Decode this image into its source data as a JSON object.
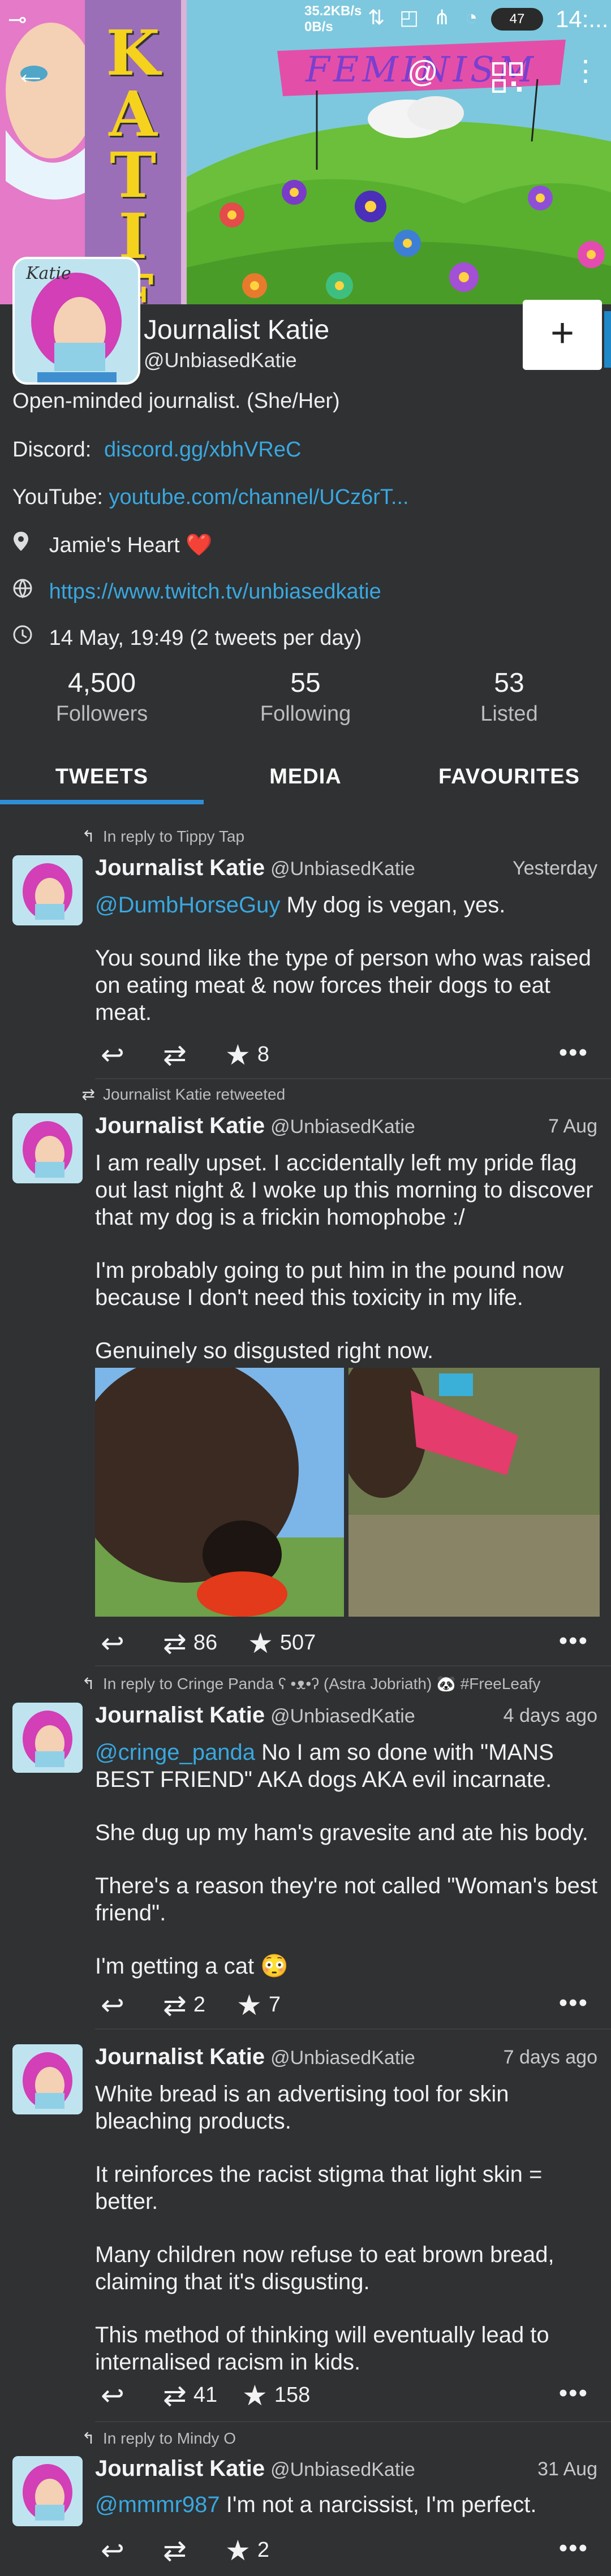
{
  "status_bar": {
    "speed_top": "35.2KB/s",
    "speed_bottom": "0B/s",
    "battery": "47",
    "time": "14:..."
  },
  "banner": {
    "sign_text": "FEMINISM",
    "vertical_text": [
      "K",
      "A",
      "T",
      "I",
      "E"
    ],
    "avatar_caption": "Katie"
  },
  "profile": {
    "display_name": "Journalist Katie",
    "handle": "@UnbiasedKatie",
    "follow_label": "+",
    "bio": "Open-minded journalist. (She/Her)",
    "discord_label": "Discord:",
    "discord_link": "discord.gg/xbhVReC",
    "youtube_label": "YouTube:",
    "youtube_link": "youtube.com/channel/UCz6rT...",
    "location": "Jamie's Heart ❤️",
    "website": "https://www.twitch.tv/unbiasedkatie",
    "joined": "14 May, 19:49 (2 tweets per day)",
    "stats": [
      {
        "value": "4,500",
        "label": "Followers"
      },
      {
        "value": "55",
        "label": "Following"
      },
      {
        "value": "53",
        "label": "Listed"
      }
    ]
  },
  "tabs": [
    "TWEETS",
    "MEDIA",
    "FAVOURITES"
  ],
  "tweets": [
    {
      "context": "In reply to Tippy Tap",
      "name": "Journalist Katie",
      "handle": "@UnbiasedKatie",
      "date": "Yesterday",
      "mention": "@DumbHorseGuy",
      "paragraphs": [
        "My dog is vegan, yes.",
        "You sound like the type of person who was raised on eating meat & now forces their dogs to eat meat."
      ],
      "retweets": "",
      "likes": "8"
    },
    {
      "context": "Journalist Katie retweeted",
      "name": "Journalist Katie",
      "handle": "@UnbiasedKatie",
      "date": "7 Aug",
      "paragraphs": [
        "I am really upset. I accidentally left my pride flag out last night & I woke up this morning to discover that my dog is a frickin homophobe :/",
        " I'm probably going to put him in the pound now because I don't need this toxicity in my life.",
        "Genuinely so disgusted right now."
      ],
      "retweets": "86",
      "likes": "507"
    },
    {
      "context": "In reply to Cringe Panda ʕ •ᴥ•ʔ (Astra Jobriath) 🐼 #FreeLeafy",
      "name": "Journalist Katie",
      "handle": "@UnbiasedKatie",
      "date": "4 days ago",
      "mention": "@cringe_panda",
      "paragraphs": [
        "No I am so done with \"MANS BEST FRIEND\" AKA dogs AKA evil incarnate.",
        "She dug up my ham's gravesite and ate his body.",
        "There's a reason they're not called \"Woman's best friend\".",
        "I'm getting a cat 😳"
      ],
      "retweets": "2",
      "likes": "7"
    },
    {
      "context": "",
      "name": "Journalist Katie",
      "handle": "@UnbiasedKatie",
      "date": "7 days ago",
      "paragraphs": [
        "White bread is an advertising tool for skin bleaching products.",
        "It reinforces the racist stigma that light skin = better.",
        "Many children now refuse to eat brown bread, claiming that it's disgusting.",
        "This method of thinking will eventually lead to internalised racism in kids."
      ],
      "retweets": "41",
      "likes": "158"
    },
    {
      "context": "In reply to Mindy O",
      "name": "Journalist Katie",
      "handle": "@UnbiasedKatie",
      "date": "31 Aug",
      "mention": "@mmmr987",
      "paragraphs": [
        "I'm not a narcissist, I'm perfect."
      ],
      "retweets": "",
      "likes": "2"
    }
  ],
  "colors": {
    "background": "#2f3133",
    "link": "#39a8e0",
    "tab_accent": "#2f8fd6"
  },
  "icons": [
    "back-arrow-icon",
    "mention-icon",
    "qr-code-icon",
    "more-vert-icon",
    "location-pin-icon",
    "globe-icon",
    "clock-icon",
    "reply-icon",
    "retweet-icon",
    "star-icon",
    "more-horiz-icon"
  ]
}
